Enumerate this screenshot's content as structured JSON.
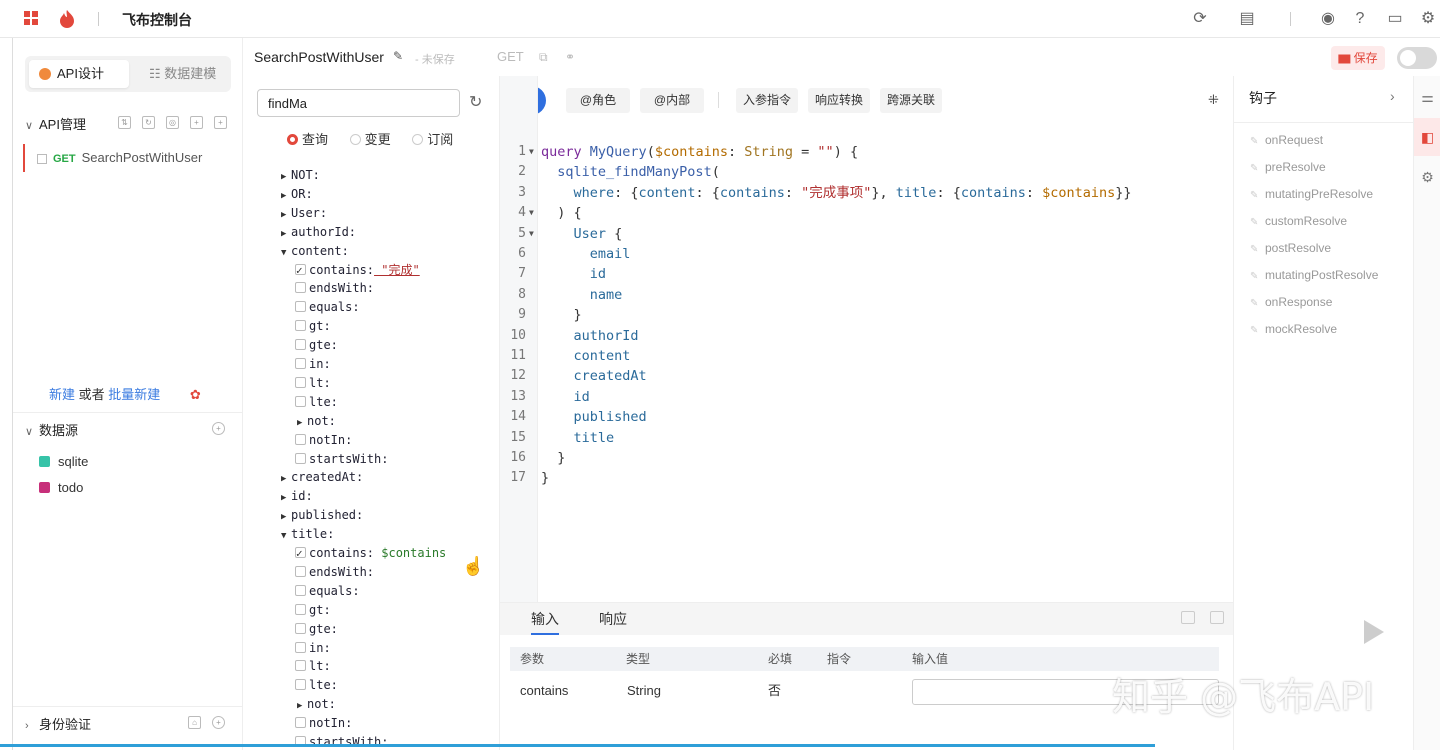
{
  "app": {
    "title": "飞布控制台"
  },
  "left": {
    "tabs": {
      "active": "API设计",
      "inactive": "数据建模"
    },
    "api_section": "API管理",
    "api_item": {
      "method": "GET",
      "name": "SearchPostWithUser"
    },
    "new_row": {
      "new": "新建",
      "or": "或者",
      "batch": "批量新建"
    },
    "datasource_section": "数据源",
    "datasources": [
      {
        "name": "sqlite",
        "color": "#36c3a8"
      },
      {
        "name": "todo",
        "color": "#c72f7a"
      }
    ],
    "auth_section": "身份验证"
  },
  "header": {
    "op_name": "SearchPostWithUser",
    "unsaved": "- 未保存",
    "method": "GET",
    "save": "保存"
  },
  "explorer": {
    "search": "findMa",
    "radios": [
      "查询",
      "变更",
      "订阅"
    ],
    "tree": [
      {
        "indent": 0,
        "kind": "arrow",
        "open": false,
        "label": "NOT:"
      },
      {
        "indent": 0,
        "kind": "arrow",
        "open": false,
        "label": "OR:"
      },
      {
        "indent": 0,
        "kind": "arrow",
        "open": false,
        "label": "User:"
      },
      {
        "indent": 0,
        "kind": "arrow",
        "open": false,
        "label": "authorId:"
      },
      {
        "indent": 0,
        "kind": "arrow",
        "open": true,
        "label": "content:"
      },
      {
        "indent": 1,
        "kind": "check",
        "checked": true,
        "label": "contains:",
        "value": "\"完成\"",
        "vtype": "str"
      },
      {
        "indent": 1,
        "kind": "check",
        "checked": false,
        "label": "endsWith:"
      },
      {
        "indent": 1,
        "kind": "check",
        "checked": false,
        "label": "equals:"
      },
      {
        "indent": 1,
        "kind": "check",
        "checked": false,
        "label": "gt:"
      },
      {
        "indent": 1,
        "kind": "check",
        "checked": false,
        "label": "gte:"
      },
      {
        "indent": 1,
        "kind": "check",
        "checked": false,
        "label": "in:"
      },
      {
        "indent": 1,
        "kind": "check",
        "checked": false,
        "label": "lt:"
      },
      {
        "indent": 1,
        "kind": "check",
        "checked": false,
        "label": "lte:"
      },
      {
        "indent": 1,
        "kind": "arrow",
        "open": false,
        "label": "not:"
      },
      {
        "indent": 1,
        "kind": "check",
        "checked": false,
        "label": "notIn:"
      },
      {
        "indent": 1,
        "kind": "check",
        "checked": false,
        "label": "startsWith:"
      },
      {
        "indent": 0,
        "kind": "arrow",
        "open": false,
        "label": "createdAt:"
      },
      {
        "indent": 0,
        "kind": "arrow",
        "open": false,
        "label": "id:"
      },
      {
        "indent": 0,
        "kind": "arrow",
        "open": false,
        "label": "published:"
      },
      {
        "indent": 0,
        "kind": "arrow",
        "open": true,
        "label": "title:"
      },
      {
        "indent": 1,
        "kind": "check",
        "checked": true,
        "label": "contains:",
        "value": "$contains",
        "vtype": "var"
      },
      {
        "indent": 1,
        "kind": "check",
        "checked": false,
        "label": "endsWith:"
      },
      {
        "indent": 1,
        "kind": "check",
        "checked": false,
        "label": "equals:"
      },
      {
        "indent": 1,
        "kind": "check",
        "checked": false,
        "label": "gt:"
      },
      {
        "indent": 1,
        "kind": "check",
        "checked": false,
        "label": "gte:"
      },
      {
        "indent": 1,
        "kind": "check",
        "checked": false,
        "label": "in:"
      },
      {
        "indent": 1,
        "kind": "check",
        "checked": false,
        "label": "lt:"
      },
      {
        "indent": 1,
        "kind": "check",
        "checked": false,
        "label": "lte:"
      },
      {
        "indent": 1,
        "kind": "arrow",
        "open": false,
        "label": "not:"
      },
      {
        "indent": 1,
        "kind": "check",
        "checked": false,
        "label": "notIn:"
      },
      {
        "indent": 1,
        "kind": "check",
        "checked": false,
        "label": "startsWith:"
      }
    ]
  },
  "toolbar": {
    "role": "@角色",
    "internal": "@内部",
    "buttons": [
      "入参指令",
      "响应转换",
      "跨源关联"
    ]
  },
  "code": [
    {
      "n": "1",
      "fold": true,
      "tokens": [
        [
          "kw",
          "query "
        ],
        [
          "fn",
          "MyQuery"
        ],
        [
          "pl",
          "("
        ],
        [
          "sv",
          "$contains"
        ],
        [
          "pl",
          ": "
        ],
        [
          "ty",
          "String"
        ],
        [
          "pl",
          " = "
        ],
        [
          "s",
          "\"\""
        ],
        [
          "pl",
          ") {"
        ]
      ]
    },
    {
      "n": "2",
      "fold": false,
      "tokens": [
        [
          "pl",
          "  "
        ],
        [
          "fn",
          "sqlite_findManyPost"
        ],
        [
          "pl",
          "("
        ]
      ]
    },
    {
      "n": "3",
      "fold": false,
      "tokens": [
        [
          "pl",
          "    "
        ],
        [
          "fl",
          "where"
        ],
        [
          "pl",
          ": {"
        ],
        [
          "fl",
          "content"
        ],
        [
          "pl",
          ": {"
        ],
        [
          "fl",
          "contains"
        ],
        [
          "pl",
          ": "
        ],
        [
          "s",
          "\"完成事项\""
        ],
        [
          "pl",
          "}, "
        ],
        [
          "fl",
          "title"
        ],
        [
          "pl",
          ": {"
        ],
        [
          "fl",
          "contains"
        ],
        [
          "pl",
          ": "
        ],
        [
          "sv",
          "$contains"
        ],
        [
          "pl",
          "}}"
        ]
      ]
    },
    {
      "n": "4",
      "fold": true,
      "tokens": [
        [
          "pl",
          "  ) {"
        ]
      ]
    },
    {
      "n": "5",
      "fold": true,
      "tokens": [
        [
          "pl",
          "    "
        ],
        [
          "fl",
          "User"
        ],
        [
          "pl",
          " {"
        ]
      ]
    },
    {
      "n": "6",
      "fold": false,
      "tokens": [
        [
          "pl",
          "      "
        ],
        [
          "fl",
          "email"
        ]
      ]
    },
    {
      "n": "7",
      "fold": false,
      "tokens": [
        [
          "pl",
          "      "
        ],
        [
          "fl",
          "id"
        ]
      ]
    },
    {
      "n": "8",
      "fold": false,
      "tokens": [
        [
          "pl",
          "      "
        ],
        [
          "fl",
          "name"
        ]
      ]
    },
    {
      "n": "9",
      "fold": false,
      "tokens": [
        [
          "pl",
          "    }"
        ]
      ]
    },
    {
      "n": "10",
      "fold": false,
      "tokens": [
        [
          "pl",
          "    "
        ],
        [
          "fl",
          "authorId"
        ]
      ]
    },
    {
      "n": "11",
      "fold": false,
      "tokens": [
        [
          "pl",
          "    "
        ],
        [
          "fl",
          "content"
        ]
      ]
    },
    {
      "n": "12",
      "fold": false,
      "tokens": [
        [
          "pl",
          "    "
        ],
        [
          "fl",
          "createdAt"
        ]
      ]
    },
    {
      "n": "13",
      "fold": false,
      "tokens": [
        [
          "pl",
          "    "
        ],
        [
          "fl",
          "id"
        ]
      ]
    },
    {
      "n": "14",
      "fold": false,
      "tokens": [
        [
          "pl",
          "    "
        ],
        [
          "fl",
          "published"
        ]
      ]
    },
    {
      "n": "15",
      "fold": false,
      "tokens": [
        [
          "pl",
          "    "
        ],
        [
          "fl",
          "title"
        ]
      ]
    },
    {
      "n": "16",
      "fold": false,
      "tokens": [
        [
          "pl",
          "  }"
        ]
      ]
    },
    {
      "n": "17",
      "fold": false,
      "tokens": [
        [
          "pl",
          "}"
        ]
      ]
    }
  ],
  "bottom": {
    "tabs": [
      "输入",
      "响应"
    ],
    "headers": [
      "参数",
      "类型",
      "必填",
      "指令",
      "输入值"
    ],
    "row": {
      "param": "contains",
      "type": "String",
      "required": "否"
    }
  },
  "hooks": {
    "title": "钩子",
    "items": [
      "onRequest",
      "preResolve",
      "mutatingPreResolve",
      "customResolve",
      "postResolve",
      "mutatingPostResolve",
      "onResponse",
      "mockResolve"
    ]
  },
  "watermark": "知乎 @飞布API"
}
